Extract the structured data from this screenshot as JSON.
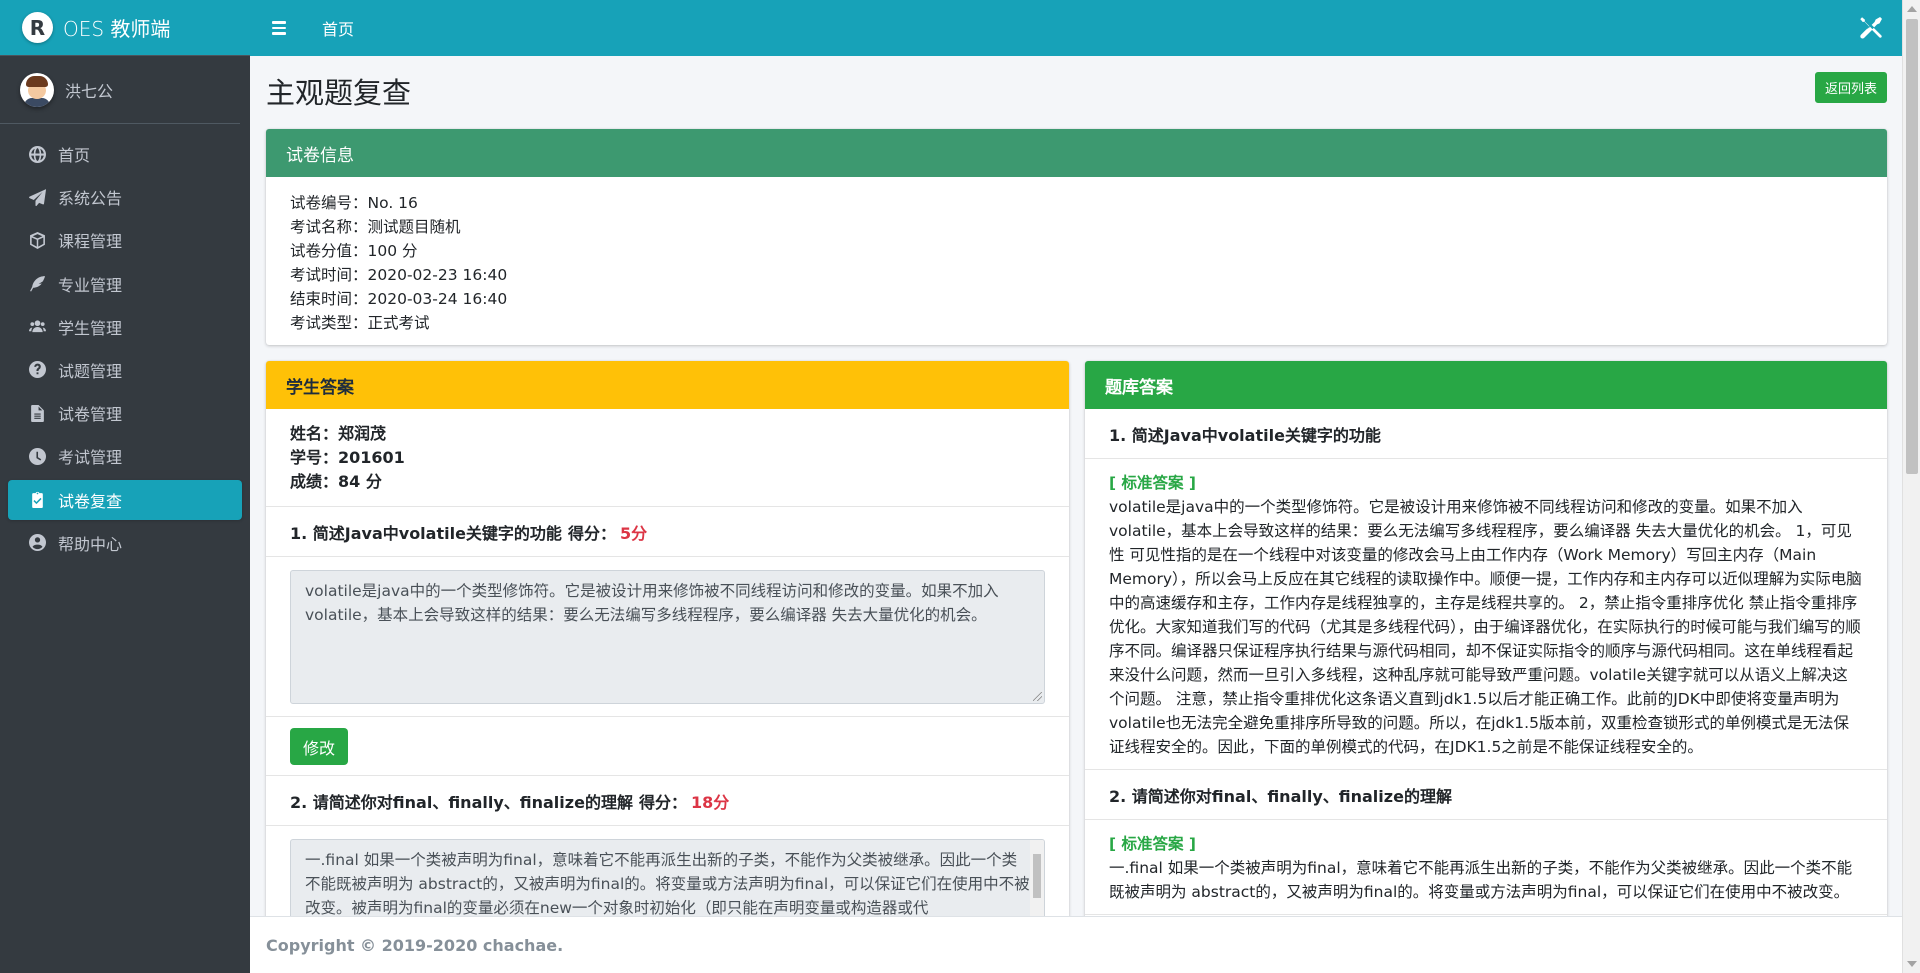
{
  "brand": {
    "logo_letter": "R",
    "name": "OES 教师端"
  },
  "user": {
    "name": "洪七公"
  },
  "topbar": {
    "home_label": "首页"
  },
  "nav": [
    {
      "label": "首页",
      "icon": "globe-icon",
      "active": false
    },
    {
      "label": "系统公告",
      "icon": "paper-plane-icon",
      "active": false
    },
    {
      "label": "课程管理",
      "icon": "cube-icon",
      "active": false
    },
    {
      "label": "专业管理",
      "icon": "feather-icon",
      "active": false
    },
    {
      "label": "学生管理",
      "icon": "users-icon",
      "active": false
    },
    {
      "label": "试题管理",
      "icon": "question-circle-icon",
      "active": false
    },
    {
      "label": "试卷管理",
      "icon": "file-icon",
      "active": false
    },
    {
      "label": "考试管理",
      "icon": "clock-icon",
      "active": false
    },
    {
      "label": "试卷复查",
      "icon": "clipboard-check-icon",
      "active": true
    },
    {
      "label": "帮助中心",
      "icon": "user-circle-icon",
      "active": false
    }
  ],
  "page": {
    "title": "主观题复查",
    "back_button": "返回列表"
  },
  "exam_info": {
    "header": "试卷信息",
    "rows": [
      {
        "key": "试卷编号：",
        "value": "No. 16"
      },
      {
        "key": "考试名称：",
        "value": "测试题目随机"
      },
      {
        "key": "试卷分值：",
        "value": "100 分"
      },
      {
        "key": "考试时间：",
        "value": "2020-02-23 16:40"
      },
      {
        "key": "结束时间：",
        "value": "2020-03-24 16:40"
      },
      {
        "key": "考试类型：",
        "value": "正式考试"
      }
    ]
  },
  "student": {
    "header": "学生答案",
    "name_line": "姓名：郑润茂",
    "id_line": "学号：201601",
    "score_line": "成绩：84 分",
    "edit_button": "修改",
    "questions": [
      {
        "title": "1. 简述Java中volatile关键字的功能",
        "score_label": "得分：",
        "score": "5分",
        "answer": "volatile是java中的一个类型修饰符。它是被设计用来修饰被不同线程访问和修改的变量。如果不加入volatile，基本上会导致这样的结果：要么无法编写多线程程序，要么编译器 失去大量优化的机会。"
      },
      {
        "title": "2. 请简述你对final、finally、finalize的理解",
        "score_label": "得分：",
        "score": "18分",
        "answer": "一.final 如果一个类被声明为final，意味着它不能再派生出新的子类，不能作为父类被继承。因此一个类不能既被声明为 abstract的，又被声明为final的。将变量或方法声明为final，可以保证它们在使用中不被改变。被声明为final的变量必须在new一个对象时初始化（即只能在声明变量或构造器或代"
      }
    ]
  },
  "bank": {
    "header": "题库答案",
    "std_label": "[ 标准答案 ]",
    "questions": [
      {
        "title": "1. 简述Java中volatile关键字的功能",
        "answer": "volatile是java中的一个类型修饰符。它是被设计用来修饰被不同线程访问和修改的变量。如果不加入volatile，基本上会导致这样的结果：要么无法编写多线程程序，要么编译器 失去大量优化的机会。 1，可见性 可见性指的是在一个线程中对该变量的修改会马上由工作内存（Work Memory）写回主内存（Main Memory），所以会马上反应在其它线程的读取操作中。顺便一提，工作内存和主内存可以近似理解为实际电脑中的高速缓存和主存，工作内存是线程独享的，主存是线程共享的。 2，禁止指令重排序优化 禁止指令重排序优化。大家知道我们写的代码（尤其是多线程代码），由于编译器优化，在实际执行的时候可能与我们编写的顺序不同。编译器只保证程序执行结果与源代码相同，却不保证实际指令的顺序与源代码相同。这在单线程看起来没什么问题，然而一旦引入多线程，这种乱序就可能导致严重问题。volatile关键字就可以从语义上解决这个问题。 注意，禁止指令重排优化这条语义直到jdk1.5以后才能正确工作。此前的JDK中即使将变量声明为volatile也无法完全避免重排序所导致的问题。所以，在jdk1.5版本前，双重检查锁形式的单例模式是无法保证线程安全的。因此，下面的单例模式的代码，在JDK1.5之前是不能保证线程安全的。"
      },
      {
        "title": "2. 请简述你对final、finally、finalize的理解",
        "answer": "一.final 如果一个类被声明为final，意味着它不能再派生出新的子类，不能作为父类被继承。因此一个类不能既被声明为 abstract的，又被声明为final的。将变量或方法声明为final，可以保证它们在使用中不被改变。"
      }
    ]
  },
  "footer": {
    "text": "Copyright © 2019-2020 chachae."
  }
}
